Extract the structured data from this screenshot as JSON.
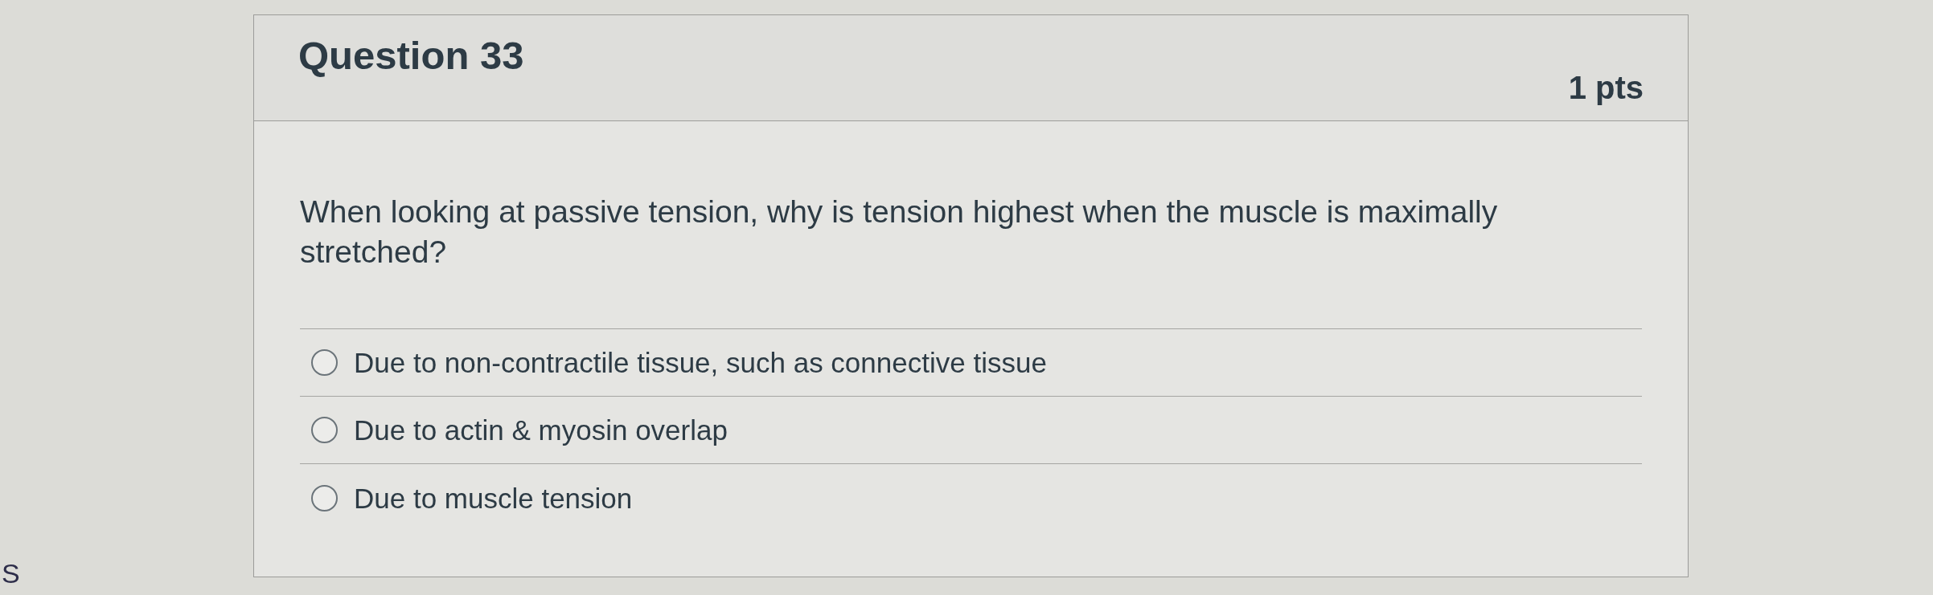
{
  "question": {
    "title": "Question 33",
    "points": "1 pts",
    "text": "When looking at passive tension, why is tension highest when the muscle is maximally stretched?"
  },
  "answers": [
    {
      "label": "Due to non-contractile tissue, such as connective tissue",
      "selected": false
    },
    {
      "label": "Due to actin & myosin overlap",
      "selected": false
    },
    {
      "label": "Due to muscle tension",
      "selected": false
    }
  ],
  "edge_text": "S"
}
